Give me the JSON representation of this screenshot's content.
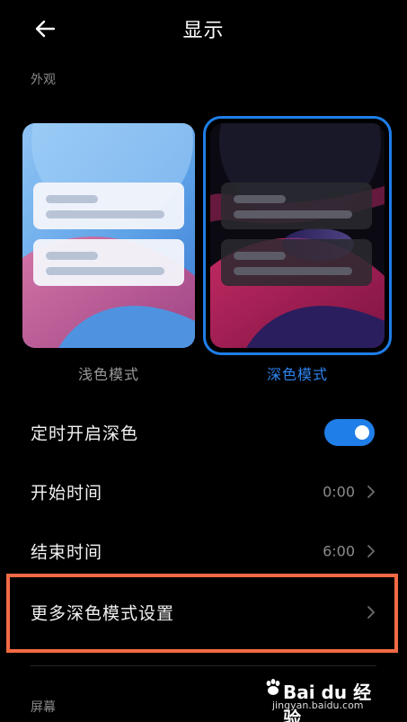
{
  "header": {
    "title": "显示",
    "back_icon": "back-arrow-icon"
  },
  "sections": {
    "appearance": "外观",
    "screen": "屏幕"
  },
  "modes": {
    "light_label": "浅色模式",
    "dark_label": "深色模式",
    "selected": "dark"
  },
  "rows": [
    {
      "label": "定时开启深色",
      "toggle_on": true
    },
    {
      "label": "开始时间",
      "value": "0:00"
    },
    {
      "label": "结束时间",
      "value": "6:00"
    },
    {
      "label": "更多深色模式设置"
    }
  ],
  "colors": {
    "accent": "#1f7ee8",
    "highlight": "#f36a44"
  },
  "watermark": {
    "brand": "Bai du 经验",
    "url": "jingyan.baidu.com"
  }
}
